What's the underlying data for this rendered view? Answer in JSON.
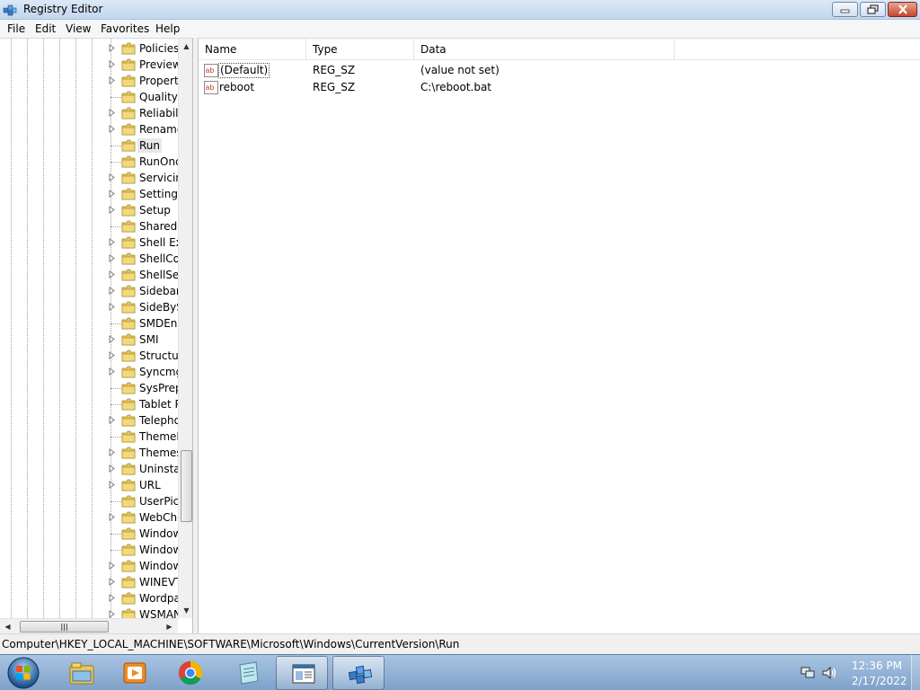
{
  "window": {
    "title": "Registry Editor",
    "controls": {
      "minimize": "minimize",
      "maximize": "restore",
      "close": "close"
    }
  },
  "menu": [
    "File",
    "Edit",
    "View",
    "Favorites",
    "Help"
  ],
  "tree": {
    "items": [
      {
        "label": "Policies",
        "expandable": true
      },
      {
        "label": "Preview",
        "expandable": true
      },
      {
        "label": "Property",
        "expandable": true
      },
      {
        "label": "QualityC",
        "expandable": false
      },
      {
        "label": "Reliabili",
        "expandable": true
      },
      {
        "label": "Rename",
        "expandable": true
      },
      {
        "label": "Run",
        "expandable": false,
        "selected": true
      },
      {
        "label": "RunOnc",
        "expandable": false
      },
      {
        "label": "Servicin",
        "expandable": true
      },
      {
        "label": "SettingS",
        "expandable": true
      },
      {
        "label": "Setup",
        "expandable": true
      },
      {
        "label": "SharedD",
        "expandable": false
      },
      {
        "label": "Shell Ext",
        "expandable": true
      },
      {
        "label": "ShellCo",
        "expandable": true
      },
      {
        "label": "ShellSer",
        "expandable": true
      },
      {
        "label": "Sidebar",
        "expandable": true
      },
      {
        "label": "SideByS",
        "expandable": true
      },
      {
        "label": "SMDEn",
        "expandable": false
      },
      {
        "label": "SMI",
        "expandable": true
      },
      {
        "label": "Structur",
        "expandable": true
      },
      {
        "label": "Syncmg",
        "expandable": true
      },
      {
        "label": "SysPrep",
        "expandable": false
      },
      {
        "label": "Tablet P",
        "expandable": false
      },
      {
        "label": "Telepho",
        "expandable": true
      },
      {
        "label": "ThemeN",
        "expandable": false
      },
      {
        "label": "Themes",
        "expandable": true
      },
      {
        "label": "Uninstal",
        "expandable": true
      },
      {
        "label": "URL",
        "expandable": true
      },
      {
        "label": "UserPict",
        "expandable": false
      },
      {
        "label": "WebChe",
        "expandable": true
      },
      {
        "label": "Window",
        "expandable": false
      },
      {
        "label": "Window",
        "expandable": false
      },
      {
        "label": "Window",
        "expandable": true
      },
      {
        "label": "WINEVT",
        "expandable": true
      },
      {
        "label": "Wordpa",
        "expandable": true
      },
      {
        "label": "WSMAN",
        "expandable": true
      }
    ]
  },
  "list": {
    "columns": [
      "Name",
      "Type",
      "Data"
    ],
    "rows": [
      {
        "name": "(Default)",
        "type": "REG_SZ",
        "data": "(value not set)",
        "focused": true
      },
      {
        "name": "reboot",
        "type": "REG_SZ",
        "data": "C:\\reboot.bat",
        "focused": false
      }
    ]
  },
  "status": {
    "path": "Computer\\HKEY_LOCAL_MACHINE\\SOFTWARE\\Microsoft\\Windows\\CurrentVersion\\Run"
  },
  "taskbar": {
    "pinned": [
      "start-orb",
      "explorer-icon",
      "media-player-icon",
      "chrome-icon",
      "notepad-icon",
      "window-icon",
      "regedit-icon"
    ],
    "active": "regedit-icon",
    "clock": {
      "time": "12:36 PM",
      "date": "2/17/2022"
    }
  },
  "colors": {
    "titlebar": "#c3d6ee",
    "taskbar": "#7ea1c9",
    "folder": "#e8c65a",
    "selection": "#e8e8e8"
  }
}
